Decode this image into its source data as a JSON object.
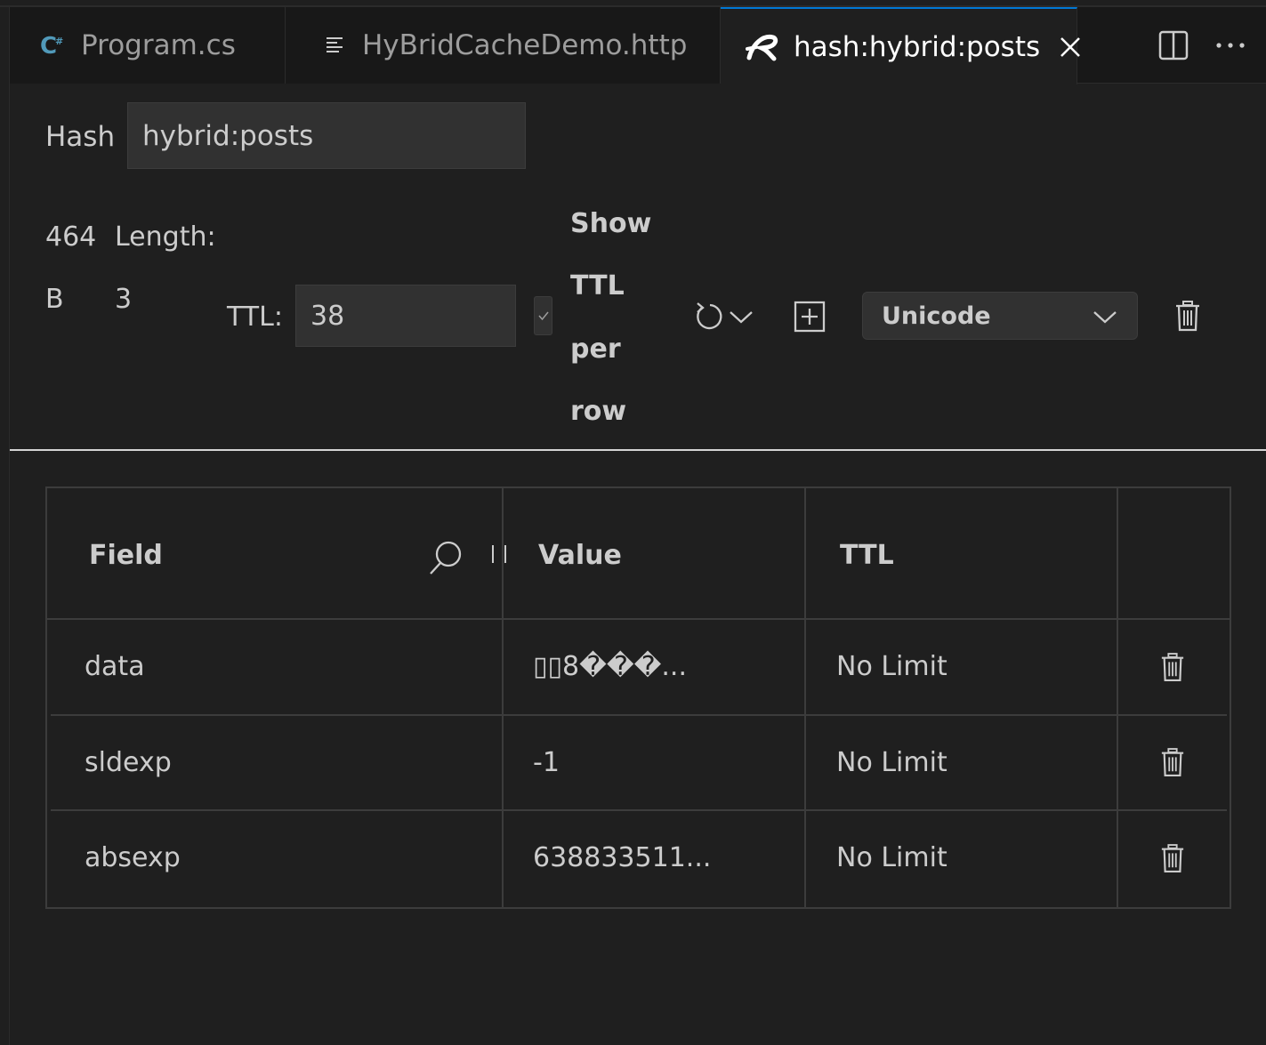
{
  "tabs": [
    {
      "label": "Program.cs",
      "icon": "csharp-icon",
      "active": false
    },
    {
      "label": "HyBridCacheDemo.http",
      "icon": "lines-icon",
      "active": false
    },
    {
      "label": "hash:hybrid:posts",
      "icon": "redis-icon",
      "active": true
    }
  ],
  "hash": {
    "label": "Hash",
    "value": "hybrid:posts"
  },
  "stats": {
    "size_number": "464",
    "size_unit": "B",
    "length_label": "Length:",
    "length_value": "3",
    "ttl_label": "TTL:",
    "ttl_value": "38"
  },
  "show_ttl": {
    "line1": "Show",
    "line2": "TTL",
    "line3": "per",
    "line4": "row",
    "checked": true
  },
  "encoding": {
    "selected": "Unicode"
  },
  "table": {
    "headers": {
      "field": "Field",
      "value": "Value",
      "ttl": "TTL"
    },
    "rows": [
      {
        "field": "data",
        "value": "▯▯8���...",
        "ttl": "No Limit"
      },
      {
        "field": "sldexp",
        "value": "-1",
        "ttl": "No Limit"
      },
      {
        "field": "absexp",
        "value": "638833511...",
        "ttl": "No Limit"
      }
    ]
  },
  "colors": {
    "accent": "#0078d4",
    "background": "#1f1f1f",
    "tabbar": "#181818",
    "input": "#313131",
    "csharp": "#519aba"
  }
}
